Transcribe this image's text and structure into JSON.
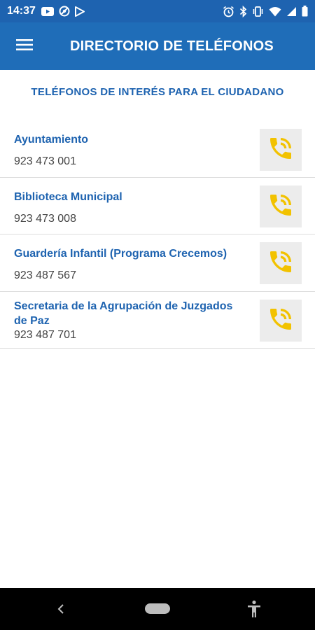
{
  "status_bar": {
    "time": "14:37",
    "left_icons": [
      "youtube-icon",
      "vpn-icon",
      "play-store-icon"
    ],
    "right_icons": [
      "alarm-icon",
      "bluetooth-icon",
      "vibrate-icon",
      "wifi-icon",
      "signal-icon",
      "battery-icon"
    ]
  },
  "app_bar": {
    "title": "DIRECTORIO DE TELÉFONOS",
    "menu_icon": "hamburger-menu-icon"
  },
  "section": {
    "title": "TELÉFONOS DE INTERÉS PARA EL CIUDADANO"
  },
  "contacts": [
    {
      "name": "Ayuntamiento",
      "phone": "923 473 001"
    },
    {
      "name": "Biblioteca Municipal",
      "phone": "923 473 008"
    },
    {
      "name": "Guardería Infantil (Programa Crecemos)",
      "phone": "923 487 567"
    },
    {
      "name": "Secretaria de la Agrupación de Juzgados de Paz",
      "phone": "923 487 701"
    }
  ],
  "call_icon": "phone-call-icon",
  "nav_bar": {
    "back_icon": "back-chevron-icon",
    "home_icon": "home-pill-icon",
    "accessibility_icon": "accessibility-icon"
  },
  "colors": {
    "app_bar": "#1f6db8",
    "status_bar": "#1e63b0",
    "accent_text": "#1e63b0",
    "call_icon": "#f2c200",
    "call_button_bg": "#ececec"
  }
}
